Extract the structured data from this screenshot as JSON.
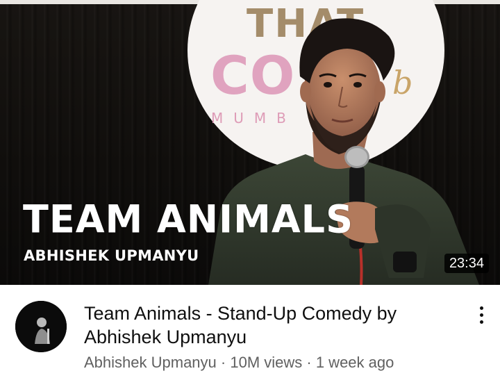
{
  "thumbnail": {
    "title_text": "TEAM ANIMALS",
    "subtitle_text": "ABHISHEK UPMANYU",
    "duration": "23:34",
    "backdrop_logo": {
      "line1": "THAT",
      "line2": "CO",
      "line3": "MUMB",
      "script": "b",
      "colors": {
        "gold": "#a48c6a",
        "pink": "#e0a3bf"
      }
    }
  },
  "video": {
    "title": "Team Animals - Stand-Up Comedy by Abhishek Upmanyu",
    "channel": "Abhishek Upmanyu",
    "separator": " · ",
    "views": "10M views",
    "age": "1 week ago"
  },
  "icons": {
    "more": "more-vert-icon",
    "avatar": "channel-avatar"
  },
  "colors": {
    "title_text": "#0f0f0f",
    "meta_text": "#606060",
    "duration_bg": "#000000"
  }
}
